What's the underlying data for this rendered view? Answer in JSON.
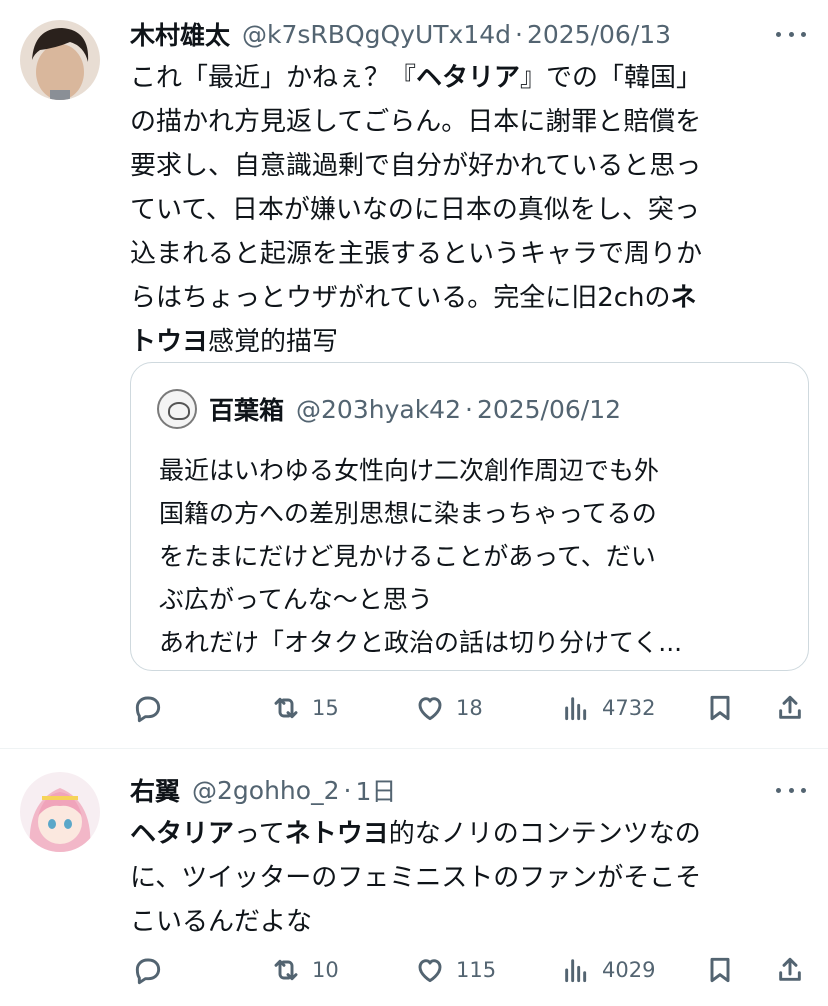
{
  "tweets": [
    {
      "author_name": "木村雄太",
      "handle": "@k7sRBQgQyUTx14d",
      "separator": "·",
      "date": "2025/06/13",
      "lines": [
        [
          {
            "t": "これ「最近」かねぇ？『",
            "b": false
          },
          {
            "t": "ヘタリア",
            "b": true
          },
          {
            "t": "』での「韓国」",
            "b": false
          }
        ],
        [
          {
            "t": "の描かれ方見返してごらん。日本に謝罪と賠償を",
            "b": false
          }
        ],
        [
          {
            "t": "要求し、自意識過剰で自分が好かれていると思っ",
            "b": false
          }
        ],
        [
          {
            "t": "ていて、日本が嫌いなのに日本の真似をし、突っ",
            "b": false
          }
        ],
        [
          {
            "t": "込まれると起源を主張するというキャラで周りか",
            "b": false
          }
        ],
        [
          {
            "t": "らはちょっとウザがれている。完全に旧2chの",
            "b": false
          },
          {
            "t": "ネ",
            "b": true
          }
        ],
        [
          {
            "t": "トウヨ",
            "b": true
          },
          {
            "t": "感覚的描写",
            "b": false
          }
        ]
      ],
      "quote": {
        "author_name": "百葉箱",
        "handle": "@203hyak42",
        "separator": "·",
        "date": "2025/06/12",
        "lines": [
          "最近はいわゆる女性向け二次創作周辺でも外",
          "国籍の方への差別思想に染まっちゃってるの",
          "をたまにだけど見かけることがあって、だい",
          "ぶ広がってんな〜と思う",
          "あれだけ「オタクと政治の話は切り分けてく..."
        ]
      },
      "actions": {
        "reply": "",
        "retweets": "15",
        "likes": "18",
        "views": "4732"
      }
    },
    {
      "author_name": "右翼",
      "handle": "@2gohho_2",
      "separator": "·",
      "date": "1日",
      "lines": [
        [
          {
            "t": "ヘタリア",
            "b": true
          },
          {
            "t": "って",
            "b": false
          },
          {
            "t": "ネトウヨ",
            "b": true
          },
          {
            "t": "的なノリのコンテンツなの",
            "b": false
          }
        ],
        [
          {
            "t": "に、ツイッターのフェミニストのファンがそこそ",
            "b": false
          }
        ],
        [
          {
            "t": "こいるんだよな",
            "b": false
          }
        ]
      ],
      "actions": {
        "reply": "",
        "retweets": "10",
        "likes": "115",
        "views": "4029"
      }
    }
  ],
  "icons": {
    "more": "more-dots-icon",
    "reply": "reply-icon",
    "retweet": "retweet-icon",
    "like": "heart-icon",
    "views": "views-chart-icon",
    "bookmark": "bookmark-icon",
    "share": "share-icon"
  }
}
